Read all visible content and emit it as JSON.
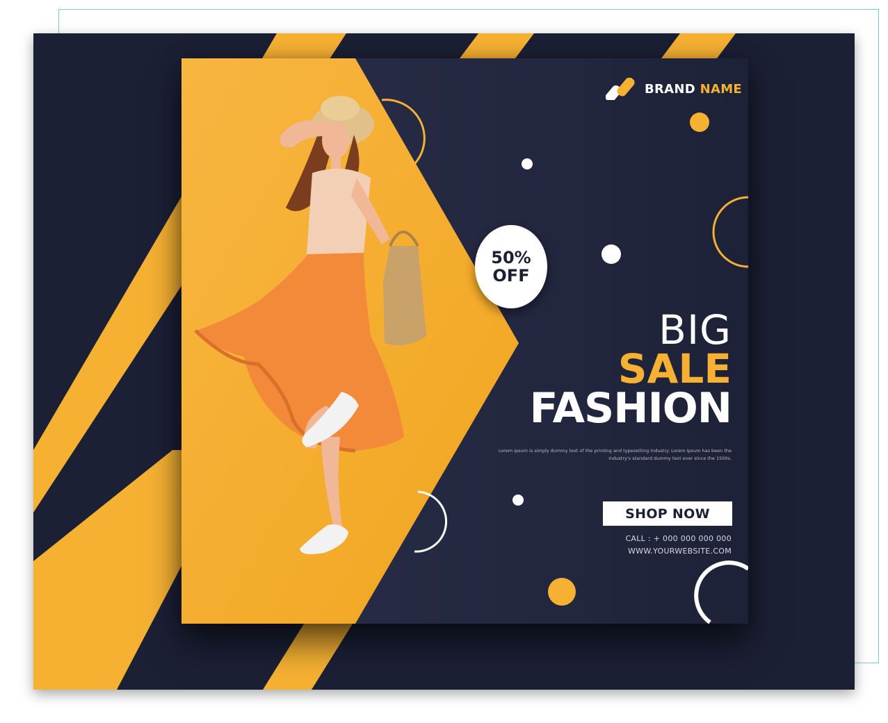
{
  "brand": {
    "name_part1": "BRAND",
    "name_part2": "NAME"
  },
  "badge": {
    "line1": "50%",
    "line2": "OFF"
  },
  "headline": {
    "line1": "BIG",
    "line2": "SALE",
    "line3": "FASHION"
  },
  "description": "Lorem ipsum is simply dummy text of the printing and typesetting industry. Lorem Ipsum has been the industry's standard dummy text ever since the 1500s.",
  "cta": {
    "label": "SHOP NOW"
  },
  "contact": {
    "phone": "CALL : + 000 000 000 000",
    "website": "WWW.YOURWEBSITE.COM"
  },
  "colors": {
    "navy": "#1c2035",
    "accent": "#f6b133",
    "white": "#ffffff"
  }
}
